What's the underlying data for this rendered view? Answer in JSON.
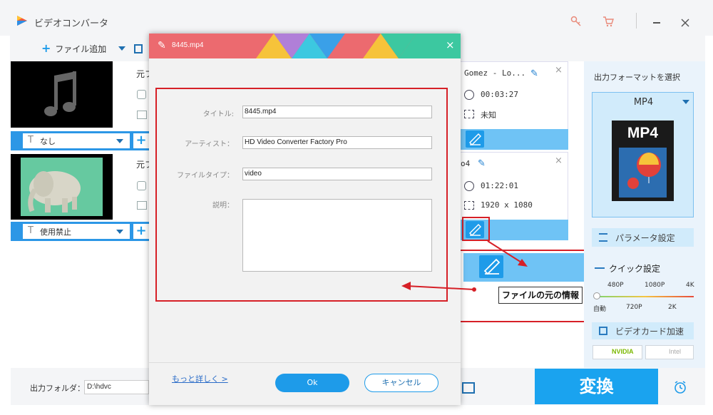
{
  "app": {
    "title": "ビデオコンバータ",
    "add_file_label": "ファイル追加"
  },
  "file_list": {
    "items": [
      {
        "source_label": "元フ",
        "subtitle_label": "なし"
      },
      {
        "source_label": "元フ",
        "subtitle_label": "使用禁止"
      }
    ]
  },
  "file_info": {
    "file1": {
      "name": "Gomez - Lo...",
      "duration": "00:03:27",
      "resolution": "未知"
    },
    "file2": {
      "name": "o4",
      "duration": "01:22:01",
      "resolution": "1920 x 1080"
    }
  },
  "tooltip": {
    "text": "ファイルの元の情報"
  },
  "right_panel": {
    "select_format_label": "出力フォーマットを選択",
    "format_name": "MP4",
    "format_thumb_text": "MP4",
    "params_label": "パラメータ設定",
    "quick_label": "クイック設定",
    "quick_top_labels": [
      "480P",
      "1080P",
      "4K"
    ],
    "quick_bottom_labels": [
      "自動",
      "720P",
      "2K"
    ],
    "gpu_label": "ビデオカード加速",
    "nvidia_label": "NVIDIA",
    "intel_label": "Intel"
  },
  "bottom": {
    "output_folder_label": "出力フォルダ：",
    "output_folder_value": "D:\\hdvc",
    "convert_label": "変換"
  },
  "dialog": {
    "title": "8445.mp4",
    "fields": {
      "title_label": "タイトル:",
      "title_value": "8445.mp4",
      "artist_label": "アーティスト：",
      "artist_value": "HD Video Converter Factory Pro",
      "filetype_label": "ファイルタイプ：",
      "filetype_value": "video",
      "description_label": "説明：",
      "description_value": ""
    },
    "more_link": "もっと詳しく >",
    "ok_label": "Ok",
    "cancel_label": "キャンセル"
  },
  "colors": {
    "accent": "#1e9be9",
    "accent_light": "#6fc3f5",
    "annotation_red": "#d62027"
  }
}
